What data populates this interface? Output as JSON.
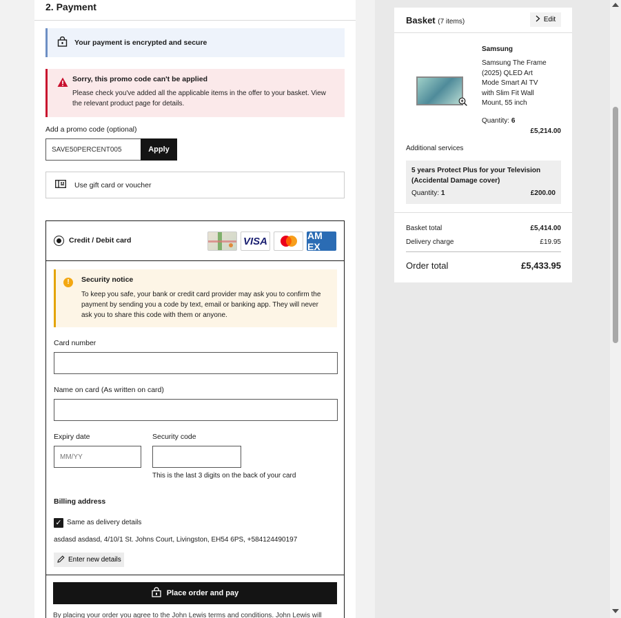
{
  "payment": {
    "section_title": "2. Payment",
    "secure_notice": "Your payment is encrypted and secure",
    "error": {
      "title": "Sorry, this promo code can't be applied",
      "message": "Please check you've added all the applicable items in the offer to your basket. View the relevant product page for details."
    },
    "promo": {
      "label": "Add a promo code (optional)",
      "value": "SAVE50PERCENT005",
      "apply_label": "Apply"
    },
    "gift_card_label": "Use gift card or voucher",
    "card": {
      "type_label": "Credit / Debit card",
      "logos": [
        "gift-card",
        "VISA",
        "mastercard",
        "AMEX"
      ],
      "visa_text": "VISA",
      "amex_text": "AM EX",
      "security_notice": {
        "icon_text": "!",
        "title": "Security notice",
        "message": "To keep you safe, your bank or credit card provider may ask you to confirm the payment by sending you a code by text, email or banking app. They will never ask you to share this code with them or anyone."
      },
      "card_number_label": "Card number",
      "card_number_value": "",
      "name_label": "Name on card (As written on card)",
      "name_value": "",
      "expiry_label": "Expiry date",
      "expiry_placeholder": "MM/YY",
      "security_code_label": "Security code",
      "security_code_value": "",
      "security_code_hint": "This is the last 3 digits on the back of your card"
    },
    "billing": {
      "title": "Billing address",
      "same_as_delivery_label": "Same as delivery details",
      "same_as_delivery_checked": true,
      "address": "asdasd asdasd, 4/10/1 St. Johns Court, Livingston, EH54 6PS, +584124490197",
      "enter_new_label": "Enter new details"
    },
    "place_order_label": "Place order and pay",
    "terms_text": "By placing your order you agree to the John Lewis terms and conditions. John Lewis will"
  },
  "basket": {
    "title": "Basket",
    "count": "(7 items)",
    "edit_label": "Edit",
    "item": {
      "brand": "Samsung",
      "name": "Samsung The Frame (2025) QLED Art Mode Smart AI TV with Slim Fit Wall Mount, 55 inch",
      "quantity_label": "Quantity:",
      "quantity": "6",
      "price": "£5,214.00"
    },
    "additional_services_label": "Additional services",
    "service": {
      "name": "5 years Protect Plus for your Television (Accidental Damage cover)",
      "quantity_label": "Quantity:",
      "quantity": "1",
      "price": "£200.00"
    },
    "summary": {
      "basket_total_label": "Basket total",
      "basket_total": "£5,414.00",
      "delivery_label": "Delivery charge",
      "delivery": "£19.95",
      "order_total_label": "Order total",
      "order_total": "£5,433.95"
    }
  },
  "colors": {
    "error_accent": "#c8102e",
    "info_accent": "#6d8fc4",
    "warning_accent": "#e4a400",
    "primary_button": "#141414"
  }
}
